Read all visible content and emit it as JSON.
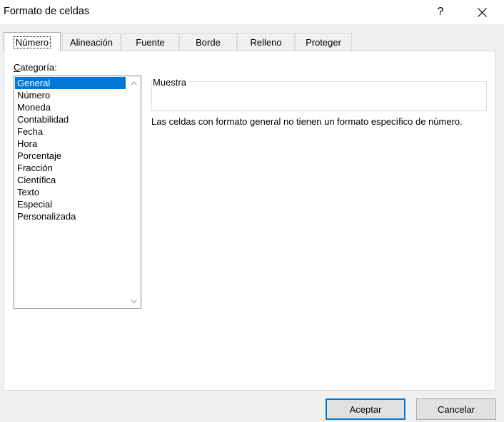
{
  "window": {
    "title": "Formato de celdas",
    "help_label": "?"
  },
  "tabs": [
    {
      "label": "Número",
      "active": true
    },
    {
      "label": "Alineación",
      "active": false
    },
    {
      "label": "Fuente",
      "active": false
    },
    {
      "label": "Borde",
      "active": false
    },
    {
      "label": "Relleno",
      "active": false
    },
    {
      "label": "Proteger",
      "active": false
    }
  ],
  "category": {
    "label_underlined": "C",
    "label_rest": "ategoría:",
    "selected_index": 0,
    "items": [
      "General",
      "Número",
      "Moneda",
      "Contabilidad",
      "Fecha",
      "Hora",
      "Porcentaje",
      "Fracción",
      "Científica",
      "Texto",
      "Especial",
      "Personalizada"
    ]
  },
  "sample": {
    "label": "Muestra",
    "value": ""
  },
  "description": "Las celdas con formato general no tienen un formato específico de número.",
  "buttons": {
    "ok_label": "Aceptar",
    "cancel_label": "Cancelar"
  },
  "colors": {
    "selection": "#0078d7",
    "dialog_bg": "#f0f0f0",
    "panel_bg": "#ffffff"
  },
  "icons": {
    "close": "close-icon",
    "scroll_up": "chevron-up-icon",
    "scroll_down": "chevron-down-icon"
  }
}
